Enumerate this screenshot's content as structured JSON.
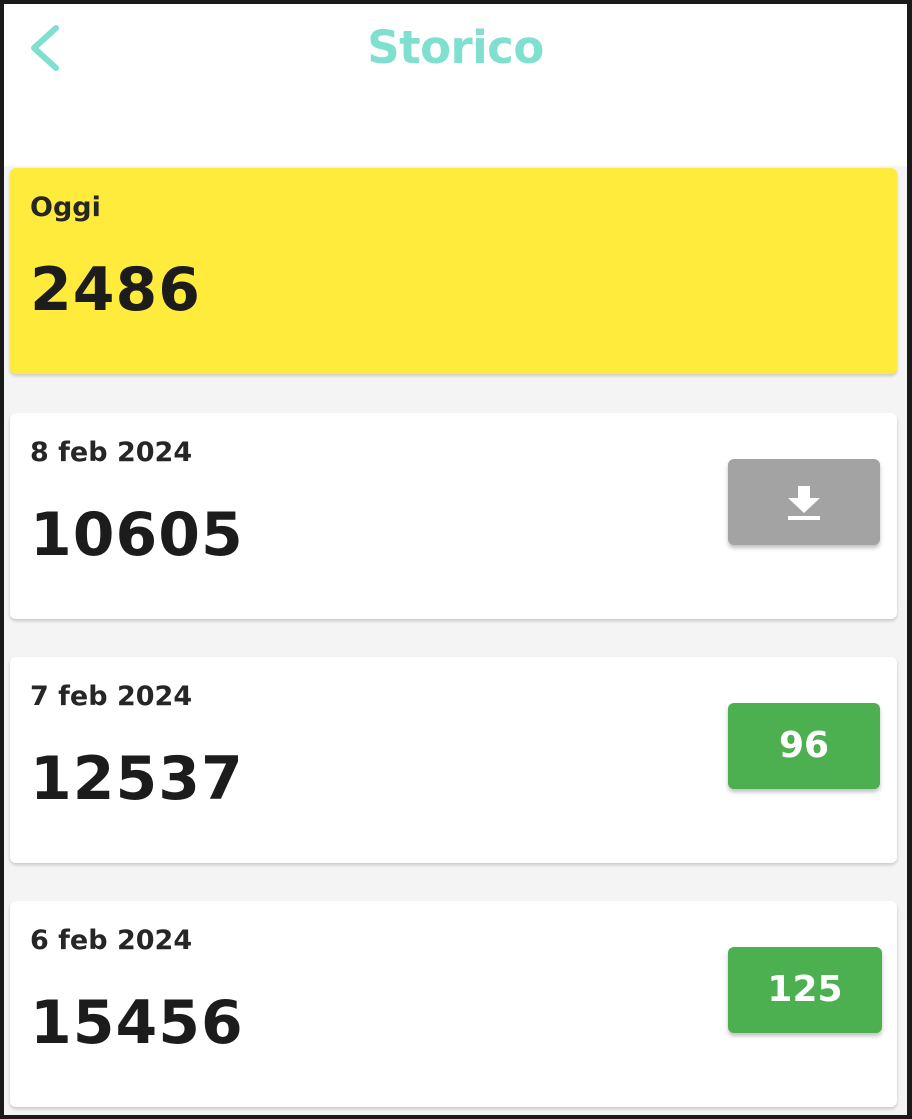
{
  "header": {
    "title": "Storico",
    "back_icon": "chevron-left-icon"
  },
  "colors": {
    "accent": "#7fe0cf",
    "today_card": "#ffeb3b",
    "download_button": "#a3a3a3",
    "badge": "#4caf50"
  },
  "today": {
    "label": "Oggi",
    "value": "2486"
  },
  "history": [
    {
      "date": "8 feb 2024",
      "value": "10605",
      "action": {
        "type": "download",
        "icon": "download-icon"
      }
    },
    {
      "date": "7 feb 2024",
      "value": "12537",
      "action": {
        "type": "badge",
        "label": "96"
      }
    },
    {
      "date": "6 feb 2024",
      "value": "15456",
      "action": {
        "type": "badge",
        "label": "125"
      }
    }
  ]
}
